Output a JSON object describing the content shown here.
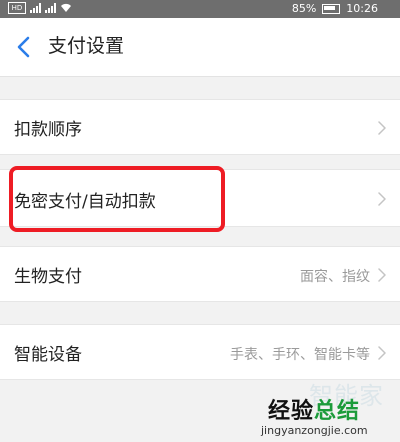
{
  "status_bar": {
    "left_badge": "HD",
    "battery_percent": "85%",
    "time": "10:26"
  },
  "header": {
    "title": "支付设置"
  },
  "settings": [
    {
      "label": "扣款顺序",
      "value": ""
    },
    {
      "label": "免密支付/自动扣款",
      "value": ""
    },
    {
      "label": "生物支付",
      "value": "面容、指纹"
    },
    {
      "label": "智能设备",
      "value": "手表、手环、智能卡等"
    }
  ],
  "watermark": {
    "top": "智能家",
    "main_prefix": "经验",
    "main_highlight": "总结",
    "url": "jingyanzongjie.com"
  },
  "colors": {
    "highlight_border": "#ee1c24",
    "back_icon": "#2b7de9",
    "watermark_green": "#1c9b3a"
  }
}
